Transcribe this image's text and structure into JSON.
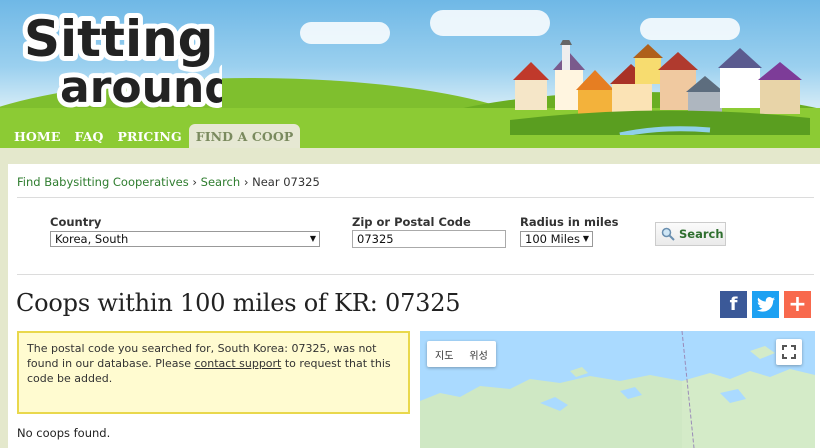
{
  "site": {
    "logo_line1": "Sitting",
    "logo_line2": "around"
  },
  "nav": [
    {
      "label": "HOME"
    },
    {
      "label": "FAQ"
    },
    {
      "label": "PRICING"
    },
    {
      "label": "FIND A COOP",
      "active": true
    }
  ],
  "breadcrumb": {
    "item1": "Find Babysitting Cooperatives",
    "sep": "›",
    "item2": "Search",
    "item3": "Near 07325"
  },
  "form": {
    "country_label": "Country",
    "country_value": "Korea, South",
    "zip_label": "Zip or Postal Code",
    "zip_value": "07325",
    "radius_label": "Radius in miles",
    "radius_value": "100 Miles",
    "search_label": "Search"
  },
  "page_title": "Coops within 100 miles of KR: 07325",
  "social": {
    "facebook": "f",
    "plus": "+"
  },
  "notice": {
    "text_before": "The postal code you searched for, South Korea: 07325, was not found in our database. Please ",
    "link": "contact support",
    "text_after": " to request that this code be added."
  },
  "no_results": "No coops found.",
  "map": {
    "tab_map": "지도",
    "tab_satellite": "위성"
  },
  "colors": {
    "nav_active": "#e6e8d3",
    "link_green": "#2f7d2f",
    "notice_bg": "#fffbd0",
    "notice_border": "#e9d84c",
    "facebook": "#3b5998",
    "twitter": "#1da1f2",
    "addthis": "#f8694d"
  }
}
